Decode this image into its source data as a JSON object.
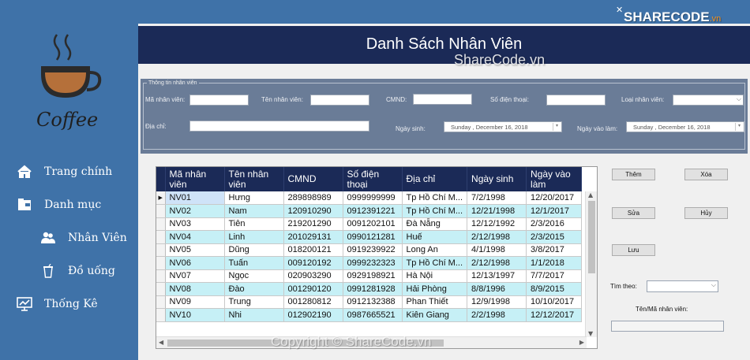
{
  "app": {
    "logo_text": "Coffee"
  },
  "brand": {
    "name": "SHARECODE",
    "tld": ".vn"
  },
  "watermarks": {
    "center": "ShareCode.vn",
    "bottom": "Copyright © ShareCode.vn"
  },
  "sidebar": {
    "items": [
      {
        "label": "Trang chính",
        "icon": "home-icon"
      },
      {
        "label": "Danh mục",
        "icon": "folder-icon"
      },
      {
        "label": "Nhân Viên",
        "icon": "users-icon"
      },
      {
        "label": "Đồ uống",
        "icon": "cup-icon"
      },
      {
        "label": "Thống Kê",
        "icon": "chart-icon"
      }
    ]
  },
  "header": {
    "title": "Danh Sách Nhân Viên"
  },
  "info": {
    "legend": "Thông tin nhân viên",
    "labels": {
      "ma_nv": "Mã nhân viên:",
      "ten_nv": "Tên nhân viên:",
      "cmnd": "CMND:",
      "sdt": "Số điện thoại:",
      "loai_nv": "Loại nhân viên:",
      "dia_chi": "Địa chỉ:",
      "ngay_sinh": "Ngày sinh:",
      "ngay_vao_lam": "Ngày vào làm:"
    },
    "ngay_sinh_value": "Sunday    ,  December 16, 2018",
    "ngay_vao_lam_value": "Sunday    ,  December 16, 2018"
  },
  "table": {
    "headers": [
      "Mã nhân viên",
      "Tên nhân viên",
      "CMND",
      "Số điện thoại",
      "Địa chỉ",
      "Ngày sinh",
      "Ngày vào làm"
    ],
    "rows": [
      [
        "NV01",
        "Hưng",
        "289898989",
        "0999999999",
        "Tp Hồ Chí M...",
        "7/2/1998",
        "12/20/2017"
      ],
      [
        "NV02",
        "Nam",
        "120910290",
        "0912391221",
        "Tp Hồ Chí M...",
        "12/21/1998",
        "12/1/2017"
      ],
      [
        "NV03",
        "Tiên",
        "219201290",
        "0091202101",
        "Đà Nẵng",
        "12/12/1992",
        "2/3/2016"
      ],
      [
        "NV04",
        "Linh",
        "201029131",
        "0990121281",
        "Huế",
        "2/12/1998",
        "2/3/2015"
      ],
      [
        "NV05",
        "Dũng",
        "018200121",
        "0919239922",
        "Long An",
        "4/1/1998",
        "3/8/2017"
      ],
      [
        "NV06",
        "Tuấn",
        "009120192",
        "0999232323",
        "Tp Hồ Chí M...",
        "2/12/1998",
        "1/1/2018"
      ],
      [
        "NV07",
        "Ngọc",
        "020903290",
        "0929198921",
        "Hà Nội",
        "12/13/1997",
        "7/7/2017"
      ],
      [
        "NV08",
        "Đào",
        "001290120",
        "0991281928",
        "Hải Phòng",
        "8/8/1996",
        "8/9/2015"
      ],
      [
        "NV09",
        "Trung",
        "001280812",
        "0912132388",
        "Phan Thiết",
        "12/9/1998",
        "10/10/2017"
      ],
      [
        "NV10",
        "Nhi",
        "012902190",
        "0987665521",
        "Kiên Giang",
        "2/2/1998",
        "12/12/2017"
      ]
    ]
  },
  "buttons": {
    "them": "Thêm",
    "xoa": "Xóa",
    "sua": "Sửa",
    "huy": "Hủy",
    "luu": "Lưu"
  },
  "search": {
    "label": "Tìm theo:",
    "sublabel": "Tên/Mã nhân viên:"
  },
  "colors": {
    "sidebar": "#3f72a8",
    "header": "#1b2a57",
    "row_alt": "#c6f0f6",
    "info_panel": "#6a7c97"
  }
}
